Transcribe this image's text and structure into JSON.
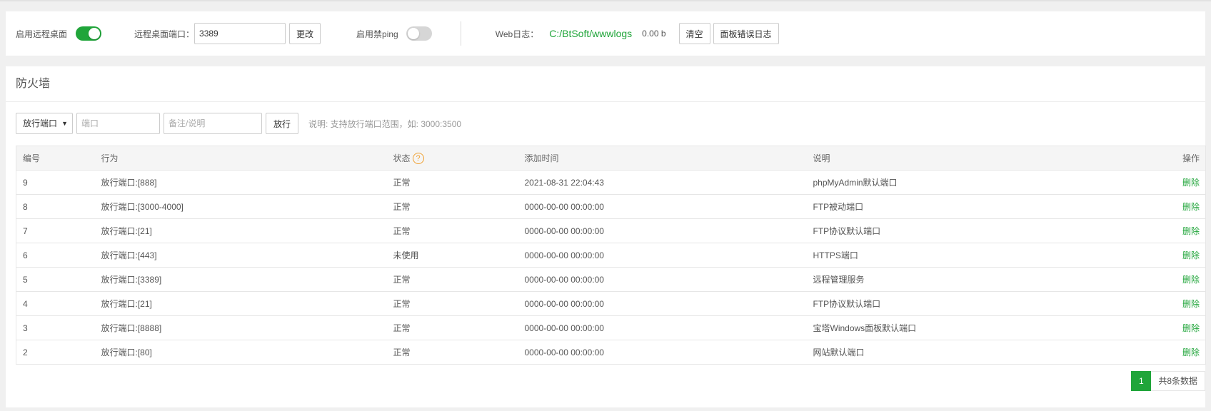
{
  "settings": {
    "remote_desktop_label": "启用远程桌面",
    "remote_desktop_enabled": true,
    "port_label": "远程桌面端口：",
    "port_value": "3389",
    "change_label": "更改",
    "ban_ping_label": "启用禁ping",
    "ban_ping_enabled": false,
    "weblog_label": "Web日志：",
    "weblog_path": "C:/BtSoft/wwwlogs",
    "weblog_size": "0.00 b",
    "clear_label": "清空",
    "panel_error_log_label": "面板错误日志"
  },
  "firewall": {
    "title": "防火墙",
    "select_value": "放行端口",
    "port_placeholder": "端口",
    "remark_placeholder": "备注/说明",
    "allow_label": "放行",
    "hint": "说明: 支持放行端口范围，如: 3000:3500",
    "columns": {
      "id": "编号",
      "action": "行为",
      "status": "状态",
      "added": "添加时间",
      "desc": "说明",
      "ops": "操作"
    },
    "status_help_icon": "question-icon",
    "rows": [
      {
        "id": "9",
        "action": "放行端口:[888]",
        "status": "正常",
        "added": "2021-08-31 22:04:43",
        "desc": "phpMyAdmin默认端口",
        "op": "删除"
      },
      {
        "id": "8",
        "action": "放行端口:[3000-4000]",
        "status": "正常",
        "added": "0000-00-00 00:00:00",
        "desc": "FTP被动端口",
        "op": "删除"
      },
      {
        "id": "7",
        "action": "放行端口:[21]",
        "status": "正常",
        "added": "0000-00-00 00:00:00",
        "desc": "FTP协议默认端口",
        "op": "删除"
      },
      {
        "id": "6",
        "action": "放行端口:[443]",
        "status": "未使用",
        "added": "0000-00-00 00:00:00",
        "desc": "HTTPS端口",
        "op": "删除"
      },
      {
        "id": "5",
        "action": "放行端口:[3389]",
        "status": "正常",
        "added": "0000-00-00 00:00:00",
        "desc": "远程管理服务",
        "op": "删除"
      },
      {
        "id": "4",
        "action": "放行端口:[21]",
        "status": "正常",
        "added": "0000-00-00 00:00:00",
        "desc": "FTP协议默认端口",
        "op": "删除"
      },
      {
        "id": "3",
        "action": "放行端口:[8888]",
        "status": "正常",
        "added": "0000-00-00 00:00:00",
        "desc": "宝塔Windows面板默认端口",
        "op": "删除"
      },
      {
        "id": "2",
        "action": "放行端口:[80]",
        "status": "正常",
        "added": "0000-00-00 00:00:00",
        "desc": "网站默认端口",
        "op": "删除"
      }
    ],
    "pager": {
      "current_page": "1",
      "total": "共8条数据"
    }
  },
  "colors": {
    "accent": "#20a53a",
    "help_icon": "#f0a030"
  }
}
